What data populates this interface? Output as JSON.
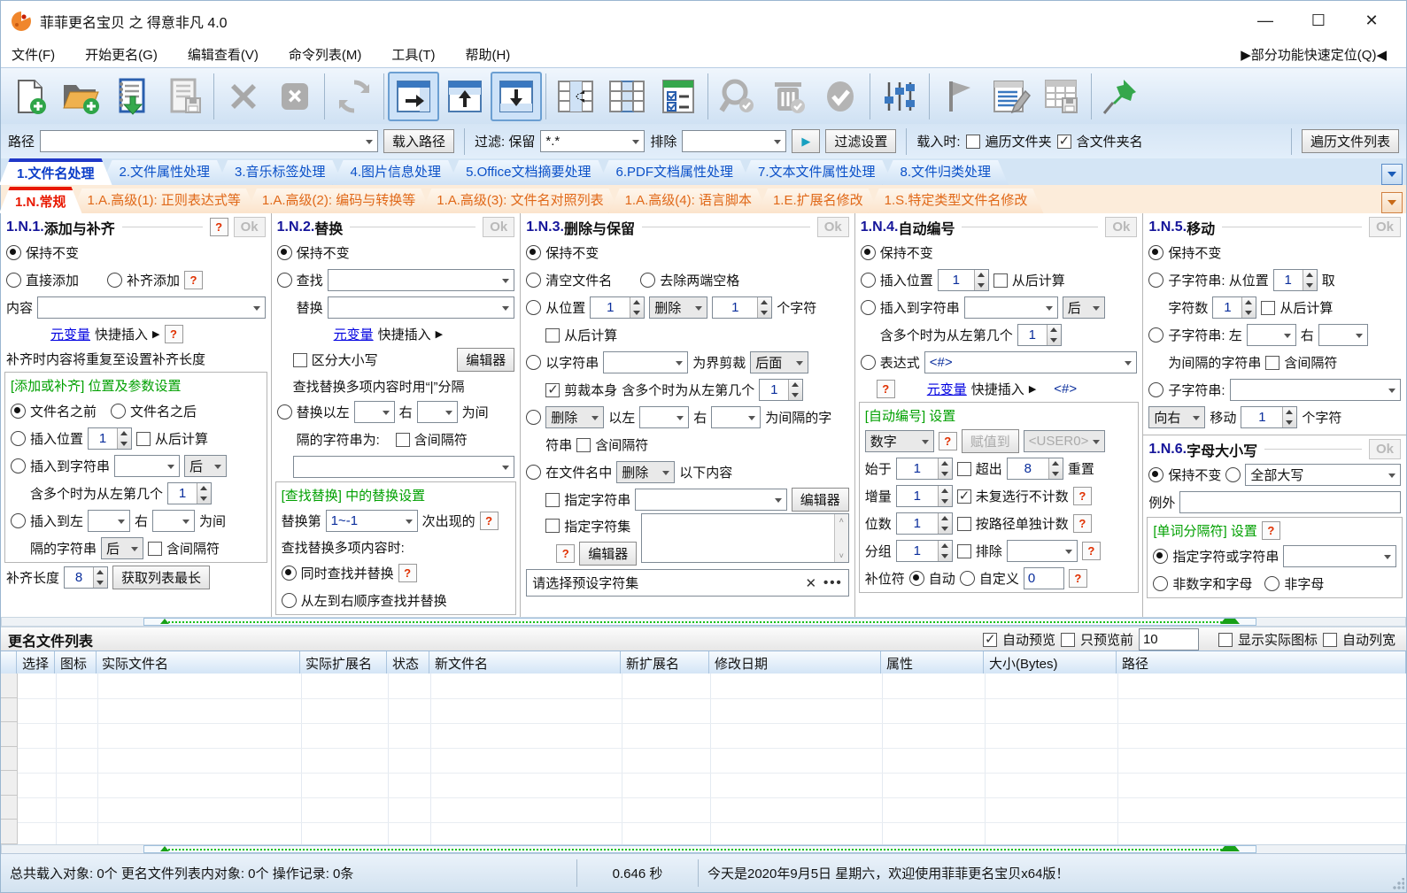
{
  "window": {
    "title": "菲菲更名宝贝 之 得意非凡 4.0",
    "minimize": "—",
    "maximize": "☐",
    "close": "✕"
  },
  "menubar": {
    "items": [
      "文件(F)",
      "开始更名(G)",
      "编辑查看(V)",
      "命令列表(M)",
      "工具(T)",
      "帮助(H)"
    ],
    "quick_nav": "▶部分功能快速定位(Q)◀"
  },
  "toolbar": {
    "icons": [
      "new-file",
      "open-folder-add",
      "import-list",
      "save-list",
      "delete",
      "delete-all",
      "refresh",
      "layout-right",
      "layout-up",
      "layout-down",
      "column-move-left",
      "column-select",
      "check-options",
      "search-check",
      "trash-check",
      "check-all",
      "sliders",
      "flag",
      "edit-table",
      "save-table",
      "pin"
    ]
  },
  "pathbar": {
    "path_label": "路径",
    "load_path_button": "载入路径",
    "filter_label": "过滤: 保留",
    "filter_value": "*.*",
    "exclude_label": "排除",
    "run_icon": "▶",
    "filter_settings_button": "过滤设置",
    "load_when_label": "载入时:",
    "traverse_folders": "遍历文件夹",
    "include_folder_name": "含文件夹名",
    "traverse_list_button": "遍历文件列表"
  },
  "tabs_main": [
    "1.文件名处理",
    "2.文件属性处理",
    "3.音乐标签处理",
    "4.图片信息处理",
    "5.Office文档摘要处理",
    "6.PDF文档属性处理",
    "7.文本文件属性处理",
    "8.文件归类处理"
  ],
  "tabs_sub": [
    "1.N.常规",
    "1.A.高级(1): 正则表达式等",
    "1.A.高级(2): 编码与转换等",
    "1.A.高级(3): 文件名对照列表",
    "1.A.高级(4): 语言脚本",
    "1.E.扩展名修改",
    "1.S.特定类型文件名修改"
  ],
  "panel1": {
    "num": "1.N.1.",
    "title": "添加与补齐",
    "help": "?",
    "ok": "Ok",
    "keep": "保持不变",
    "direct_add": "直接添加",
    "pad_add": "补齐添加",
    "content_label": "内容",
    "metavar_link": "元变量",
    "metavar_rest": "快捷插入",
    "arrow": "▶",
    "pad_note": "补齐时内容将重复至设置补齐长度",
    "group_title": "[添加或补齐] 位置及参数设置",
    "before_name": "文件名之前",
    "after_name": "文件名之后",
    "insert_pos": "插入位置",
    "pos_value": "1",
    "from_end": "从后计算",
    "insert_to_str": "插入到字符串",
    "after_opt": "后",
    "multi_note": "含多个时为从左第几个",
    "multi_value": "1",
    "insert_between": "插入到左",
    "right_label": "右",
    "between_suffix": "为间",
    "between_wrap": "隔的字符串",
    "sep_opt": "后",
    "incl_sep": "含间隔符",
    "pad_len_label": "补齐长度",
    "pad_len_value": "8",
    "get_longest_button": "获取列表最长"
  },
  "panel2": {
    "num": "1.N.2.",
    "title": "替换",
    "ok": "Ok",
    "keep": "保持不变",
    "find_label": "查找",
    "replace_label": "替换",
    "metavar_link": "元变量",
    "metavar_rest": "快捷插入",
    "arrow": "▶",
    "case_sensitive": "区分大小写",
    "editor_button": "编辑器",
    "multi_sep_note": "查找替换多项内容时用“|”分隔",
    "replace_between": "替换以左",
    "right_label": "右",
    "between_suffix": "为间",
    "between_wrap": "隔的字符串为:",
    "incl_sep": "含间隔符",
    "group_title": "[查找替换] 中的替换设置",
    "replace_nth": "替换第",
    "nth_value": "1~-1",
    "nth_suffix": "次出现的",
    "multi_when": "查找替换多项内容时:",
    "simultaneous": "同时查找并替换",
    "sequential": "从左到右顺序查找并替换"
  },
  "panel3": {
    "num": "1.N.3.",
    "title": "删除与保留",
    "ok": "Ok",
    "keep": "保持不变",
    "clear_name": "清空文件名",
    "trim_spaces": "去除两端空格",
    "from_pos": "从位置",
    "pos_value": "1",
    "del_opt": "删除",
    "count_value": "1",
    "chars_suffix": "个字符",
    "from_end": "从后计算",
    "by_string": "以字符串",
    "crop_label": "为界剪裁",
    "crop_opt": "后面",
    "crop_self": "剪裁本身",
    "multi_note": "含多个时为从左第几个",
    "multi_value": "1",
    "del_opt2": "删除",
    "between_label": "以左",
    "right_label": "右",
    "between_suffix": "为间隔的字",
    "between_wrap": "符串",
    "incl_sep": "含间隔符",
    "in_name": "在文件名中",
    "del_opt3": "删除",
    "following": "以下内容",
    "spec_string": "指定字符串",
    "editor_button": "编辑器",
    "spec_charset": "指定字符集",
    "help": "?",
    "editor_button2": "编辑器",
    "preset_placeholder": "请选择预设字符集",
    "preset_clear": "✕",
    "preset_more": "•••"
  },
  "panel4": {
    "num": "1.N.4.",
    "title": "自动编号",
    "ok": "Ok",
    "keep": "保持不变",
    "insert_pos": "插入位置",
    "pos_value": "1",
    "from_end": "从后计算",
    "insert_to_str": "插入到字符串",
    "after_opt": "后",
    "multi_note": "含多个时为从左第几个",
    "multi_value": "1",
    "expr_label": "表达式",
    "expr_value": "<#>",
    "help": "?",
    "metavar_link": "元变量",
    "metavar_rest": "快捷插入",
    "arrow": "▶",
    "expr_tag": "<#>",
    "group_title": "[自动编号] 设置",
    "type_value": "数字",
    "assign_button": "赋值到",
    "assign_target": "<USER0>",
    "start_label": "始于",
    "start_value": "1",
    "overflow_label": "超出",
    "overflow_value": "8",
    "reset_suffix": "重置",
    "incr_label": "增量",
    "incr_value": "1",
    "skip_unchecked": "未复选行不计数",
    "digits_label": "位数",
    "digits_value": "1",
    "per_path": "按路径单独计数",
    "group_label": "分组",
    "group_value": "1",
    "exclude_label": "排除",
    "pad_char_label": "补位符",
    "auto_label": "自动",
    "custom_label": "自定义",
    "custom_value": "0"
  },
  "panel5": {
    "num": "1.N.5.",
    "title": "移动",
    "ok": "Ok",
    "keep": "保持不变",
    "sub1_label": "子字符串: 从位置",
    "sub1_value": "1",
    "take_suffix": "取",
    "charcount_label": "字符数",
    "charcount_value": "1",
    "from_end": "从后计算",
    "sub2_label": "子字符串: 左",
    "right_label": "右",
    "sub2_wrap": "为间隔的字符串",
    "incl_sep": "含间隔符",
    "sub3_label": "子字符串:",
    "dir_value": "向右",
    "move_label": "移动",
    "move_value": "1",
    "move_suffix": "个字符"
  },
  "panel6": {
    "num": "1.N.6.",
    "title": "字母大小写",
    "ok": "Ok",
    "keep": "保持不变",
    "case_value": "全部大写",
    "except_label": "例外",
    "group_title": "[单词分隔符] 设置",
    "help": "?",
    "spec_char": "指定字符或字符串",
    "non_alnum": "非数字和字母",
    "non_alpha": "非字母"
  },
  "listbar": {
    "title": "更名文件列表",
    "auto_preview": "自动预览",
    "preview_first": "只预览前",
    "preview_count": "10",
    "show_real_icons": "显示实际图标",
    "auto_col_width": "自动列宽"
  },
  "table": {
    "columns": [
      "选择",
      "图标",
      "实际文件名",
      "实际扩展名",
      "状态",
      "新文件名",
      "新扩展名",
      "修改日期",
      "属性",
      "大小(Bytes)",
      "路径"
    ]
  },
  "status": {
    "counts": "总共载入对象: 0个  更名文件列表内对象: 0个  操作记录: 0条",
    "time": "0.646 秒",
    "message": "今天是2020年9月5日 星期六，欢迎使用菲菲更名宝贝x64版！"
  }
}
